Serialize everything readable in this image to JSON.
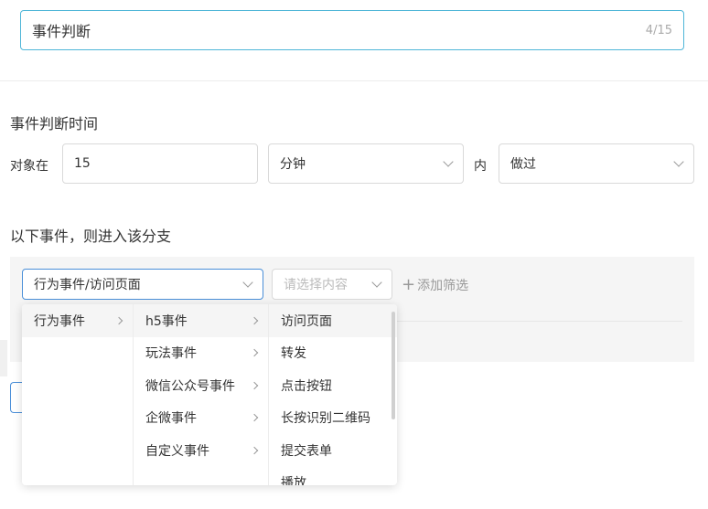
{
  "title_input": {
    "value": "事件判断",
    "counter": "4/15"
  },
  "time_section": {
    "title": "事件判断时间",
    "prefix_label": "对象在",
    "number_value": "15",
    "unit_value": "分钟",
    "mid_label": "内",
    "action_value": "做过"
  },
  "event_section": {
    "title": "以下事件，则进入该分支",
    "event_select_value": "行为事件/访问页面",
    "content_select_placeholder": "请选择内容",
    "add_filter_label": "添加筛选"
  },
  "cascader": {
    "col1": [
      {
        "label": "行为事件",
        "has_children": true,
        "selected": true
      }
    ],
    "col2": [
      {
        "label": "h5事件",
        "has_children": true,
        "selected": true
      },
      {
        "label": "玩法事件",
        "has_children": true,
        "selected": false
      },
      {
        "label": "微信公众号事件",
        "has_children": true,
        "selected": false
      },
      {
        "label": "企微事件",
        "has_children": true,
        "selected": false
      },
      {
        "label": "自定义事件",
        "has_children": true,
        "selected": false
      }
    ],
    "col3": [
      {
        "label": "访问页面",
        "selected": true
      },
      {
        "label": "转发",
        "selected": false
      },
      {
        "label": "点击按钮",
        "selected": false
      },
      {
        "label": "长按识别二维码",
        "selected": false
      },
      {
        "label": "提交表单",
        "selected": false
      },
      {
        "label": "播放",
        "selected": false
      }
    ]
  }
}
